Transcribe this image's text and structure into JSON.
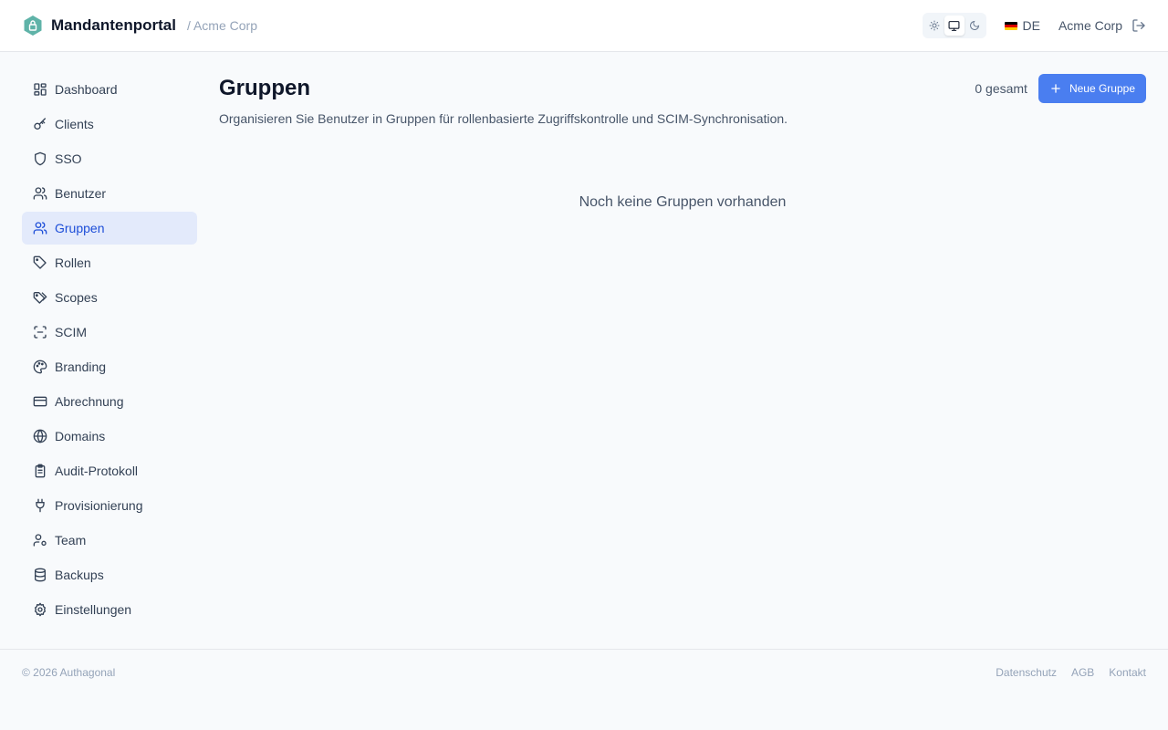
{
  "header": {
    "app_title": "Mandantenportal",
    "tenant": "/ Acme Corp",
    "language": "DE",
    "user": "Acme Corp",
    "theme_options": [
      "light-icon",
      "system-icon",
      "dark-icon"
    ],
    "active_theme": "system"
  },
  "sidebar": {
    "items": [
      {
        "label": "Dashboard",
        "icon": "dashboard-icon"
      },
      {
        "label": "Clients",
        "icon": "key-icon"
      },
      {
        "label": "SSO",
        "icon": "shield-icon"
      },
      {
        "label": "Benutzer",
        "icon": "users-icon"
      },
      {
        "label": "Gruppen",
        "icon": "users-icon",
        "active": true
      },
      {
        "label": "Rollen",
        "icon": "tag-icon"
      },
      {
        "label": "Scopes",
        "icon": "tags-icon"
      },
      {
        "label": "SCIM",
        "icon": "scan-icon"
      },
      {
        "label": "Branding",
        "icon": "palette-icon"
      },
      {
        "label": "Abrechnung",
        "icon": "credit-card-icon"
      },
      {
        "label": "Domains",
        "icon": "globe-icon"
      },
      {
        "label": "Audit-Protokoll",
        "icon": "clipboard-icon"
      },
      {
        "label": "Provisionierung",
        "icon": "plug-icon"
      },
      {
        "label": "Team",
        "icon": "user-cog-icon"
      },
      {
        "label": "Backups",
        "icon": "database-icon"
      },
      {
        "label": "Einstellungen",
        "icon": "gear-icon"
      }
    ]
  },
  "main": {
    "title": "Gruppen",
    "subtitle": "Organisieren Sie Benutzer in Gruppen für rollenbasierte Zugriffskontrolle und SCIM-Synchronisation.",
    "count": "0 gesamt",
    "new_button": "Neue Gruppe",
    "empty_state": "Noch keine Gruppen vorhanden"
  },
  "footer": {
    "copyright": "© 2026 Authagonal",
    "links": [
      "Datenschutz",
      "AGB",
      "Kontakt"
    ]
  },
  "colors": {
    "accent": "#4a7ef0",
    "active_nav_bg": "#e3eafb",
    "active_nav_text": "#1d4ed8",
    "logo": "#5fb3a8"
  }
}
